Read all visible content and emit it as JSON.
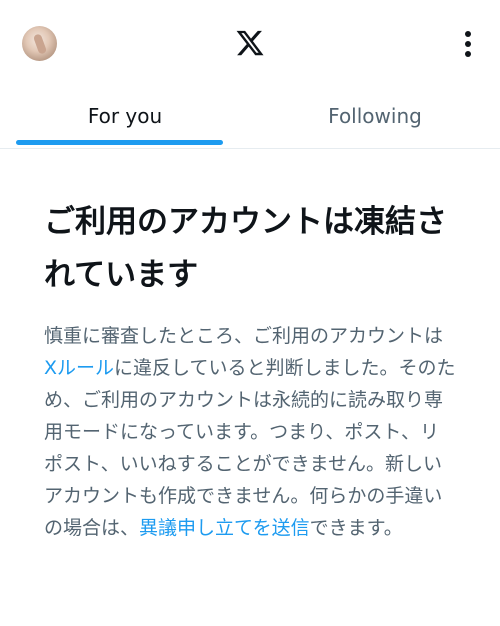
{
  "header": {
    "avatar_icon": "profile-avatar",
    "logo_icon": "x-logo",
    "menu_icon": "more-vertical-icon"
  },
  "tabs": [
    {
      "label": "For you",
      "active": true
    },
    {
      "label": "Following",
      "active": false
    }
  ],
  "notice": {
    "title": "ご利用のアカウントは凍結されています",
    "body_part1": "慎重に審査したところ、ご利用のアカウントは",
    "rules_link": "Xルール",
    "body_part2": "に違反していると判断しました。そのため、ご利用のアカウントは永続的に読み取り専用モードになっています。つまり、ポスト、リポスト、いいねすることができません。新しいアカウントも作成できません。何らかの手違いの場合は、",
    "appeal_link": "異議申し立てを送信",
    "body_part3": "できます。"
  },
  "colors": {
    "accent": "#1d9bf0",
    "text_primary": "#0f1419",
    "text_secondary": "#536471",
    "divider": "#e6ecf0"
  }
}
